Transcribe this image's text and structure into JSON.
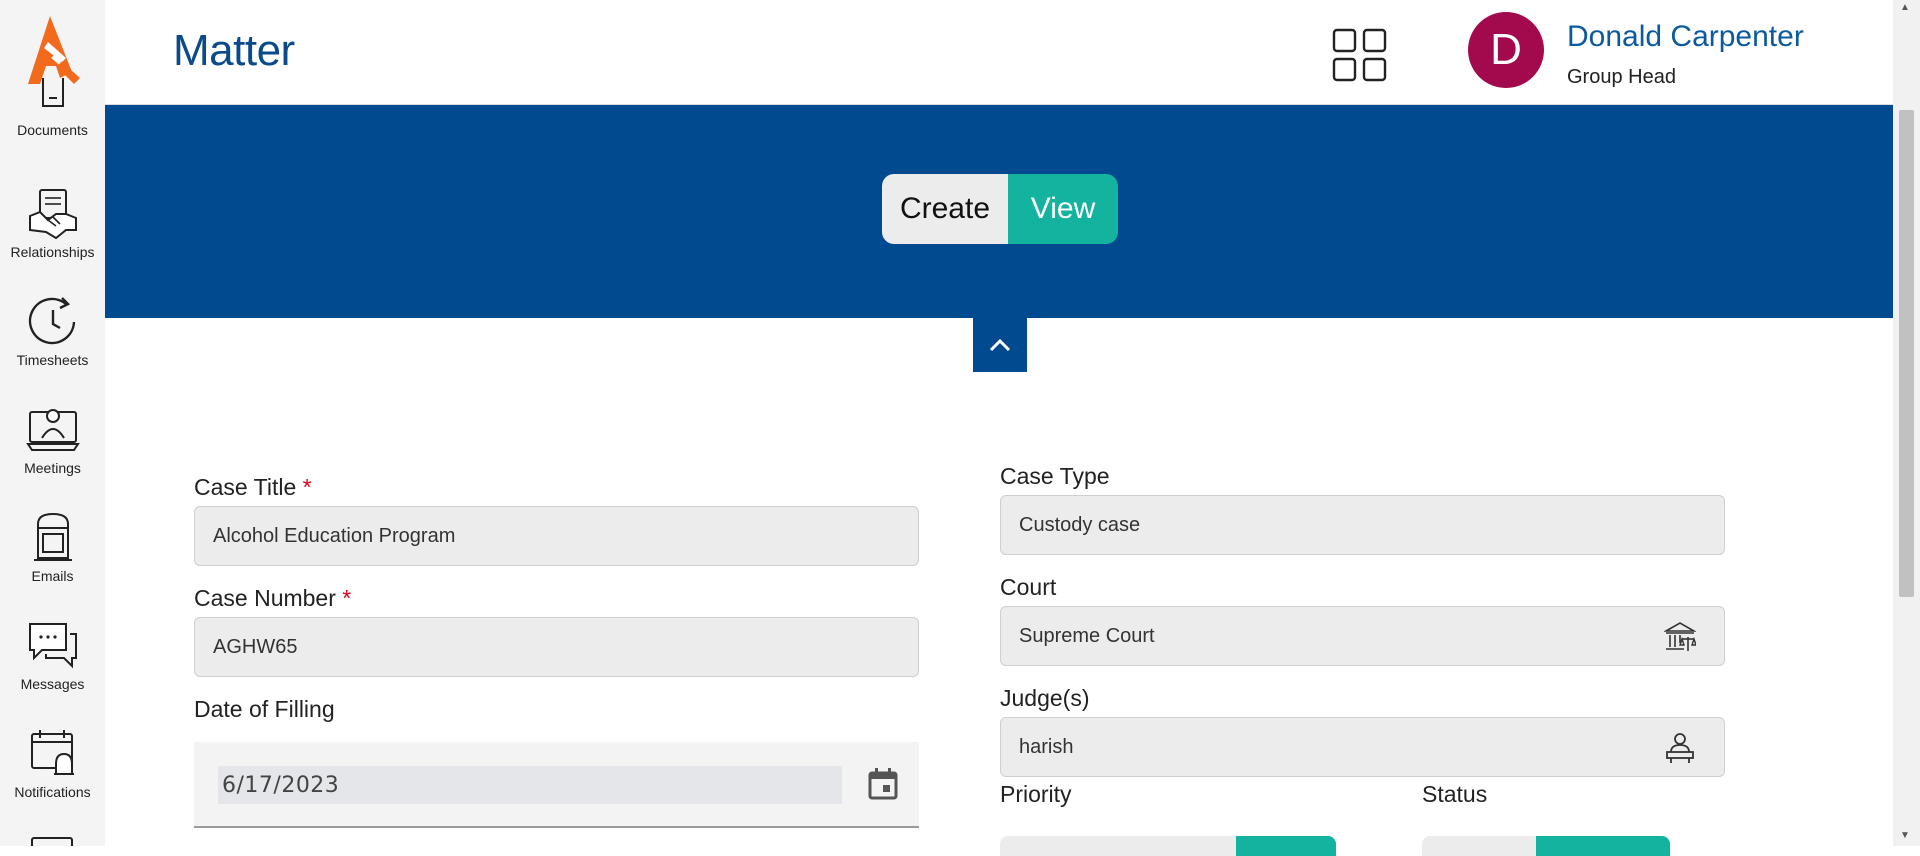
{
  "header": {
    "title": "Matter",
    "user_initial": "D",
    "user_name": "Donald Carpenter",
    "user_role": "Group Head"
  },
  "sidebar": {
    "items": [
      {
        "label": "Documents",
        "icon": "document-icon"
      },
      {
        "label": "Relationships",
        "icon": "handshake-icon"
      },
      {
        "label": "Timesheets",
        "icon": "clock-icon"
      },
      {
        "label": "Meetings",
        "icon": "meeting-icon"
      },
      {
        "label": "Emails",
        "icon": "mailbox-icon"
      },
      {
        "label": "Messages",
        "icon": "chat-icon"
      },
      {
        "label": "Notifications",
        "icon": "calendar-bell-icon"
      }
    ]
  },
  "banner": {
    "create_label": "Create",
    "view_label": "View"
  },
  "form": {
    "case_title_label": "Case Title",
    "case_title_value": "Alcohol Education Program",
    "case_number_label": "Case Number",
    "case_number_value": "AGHW65",
    "date_label": "Date of Filling",
    "date_value": "6/17/2023",
    "case_type_label": "Case Type",
    "case_type_value": "Custody case",
    "court_label": "Court",
    "court_value": "Supreme Court",
    "judges_label": "Judge(s)",
    "judges_value": "harish",
    "priority_label": "Priority",
    "status_label": "Status",
    "required_mark": "*"
  },
  "colors": {
    "brand_blue": "#014a8f",
    "accent_teal": "#14b3a0",
    "avatar": "#a3094d",
    "logo_orange": "#f26b1d"
  }
}
